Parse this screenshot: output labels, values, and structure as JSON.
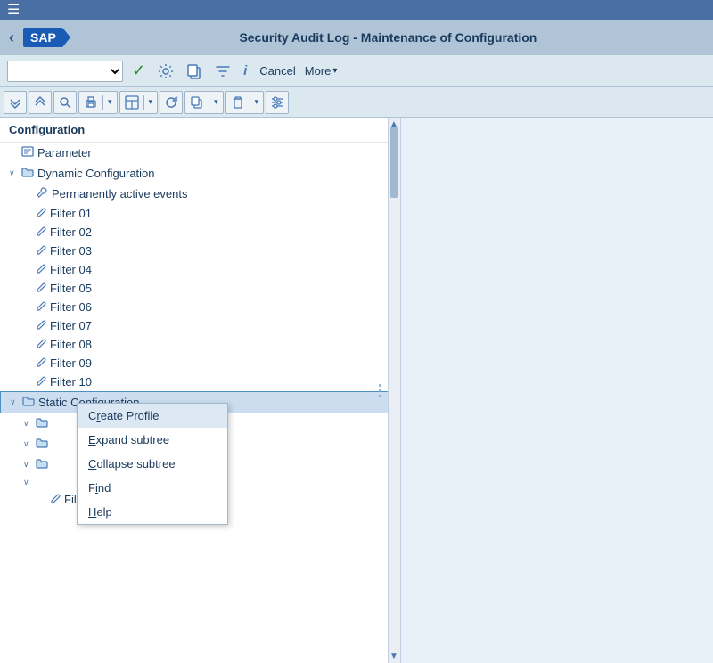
{
  "menubar": {
    "hamburger": "☰"
  },
  "header": {
    "back_label": "‹",
    "sap_logo": "SAP",
    "title": "Security Audit Log - Maintenance of Configuration"
  },
  "toolbar": {
    "select_placeholder": "",
    "check_icon": "✓",
    "tool1_icon": "⚙",
    "tool2_icon": "⧉",
    "tool3_icon": "≡",
    "tool4_icon": "ℹ",
    "cancel_label": "Cancel",
    "more_label": "More",
    "chevron_icon": "▾"
  },
  "toolbar2": {
    "btn1": "⌄⌄",
    "btn2": "⌃⌃",
    "btn3": "🔍",
    "btn4a": "⊟",
    "btn4b": "▾",
    "btn5a": "⊞",
    "btn5b": "▾",
    "btn6": "↻",
    "btn7a": "⎘",
    "btn7b": "▾",
    "btn8a": "🗑",
    "btn8b": "▾",
    "btn9": "☰"
  },
  "tree": {
    "header": "Configuration",
    "items": [
      {
        "label": "Parameter",
        "indent": 2,
        "icon": "⚙",
        "expand": ""
      },
      {
        "label": "Dynamic Configuration",
        "indent": 2,
        "icon": "📁",
        "expand": "∨"
      },
      {
        "label": "Permanently active events",
        "indent": 3,
        "icon": "✗",
        "expand": ""
      },
      {
        "label": "Filter 01",
        "indent": 3,
        "icon": "✏",
        "expand": ""
      },
      {
        "label": "Filter 02",
        "indent": 3,
        "icon": "✏",
        "expand": ""
      },
      {
        "label": "Filter 03",
        "indent": 3,
        "icon": "✏",
        "expand": ""
      },
      {
        "label": "Filter 04",
        "indent": 3,
        "icon": "✏",
        "expand": ""
      },
      {
        "label": "Filter 05",
        "indent": 3,
        "icon": "✏",
        "expand": ""
      },
      {
        "label": "Filter 06",
        "indent": 3,
        "icon": "✏",
        "expand": ""
      },
      {
        "label": "Filter 07",
        "indent": 3,
        "icon": "✏",
        "expand": ""
      },
      {
        "label": "Filter 08",
        "indent": 3,
        "icon": "✏",
        "expand": ""
      },
      {
        "label": "Filter 09",
        "indent": 3,
        "icon": "✏",
        "expand": ""
      },
      {
        "label": "Filter 10",
        "indent": 3,
        "icon": "✏",
        "expand": ""
      },
      {
        "label": "Static Configuration",
        "indent": 2,
        "icon": "📁",
        "expand": "∨",
        "selected": true
      },
      {
        "label": "",
        "indent": 3,
        "icon": "📁",
        "expand": "∨"
      },
      {
        "label": "",
        "indent": 3,
        "icon": "📁",
        "expand": "∨"
      },
      {
        "label": "",
        "indent": 3,
        "icon": "",
        "expand": "∨"
      },
      {
        "label": "",
        "indent": 3,
        "icon": "",
        "expand": "∨"
      },
      {
        "label": "Filter 01",
        "indent": 4,
        "icon": "✏",
        "expand": ""
      }
    ]
  },
  "context_menu": {
    "items": [
      {
        "label": "Create Profile",
        "underline_index": 1,
        "char": "r"
      },
      {
        "label": "Expand subtree",
        "underline_index": 0,
        "char": "E"
      },
      {
        "label": "Collapse subtree",
        "underline_index": 0,
        "char": "C"
      },
      {
        "label": "Find",
        "underline_index": 1,
        "char": "i"
      },
      {
        "label": "Help",
        "underline_index": 0,
        "char": "H"
      }
    ]
  }
}
